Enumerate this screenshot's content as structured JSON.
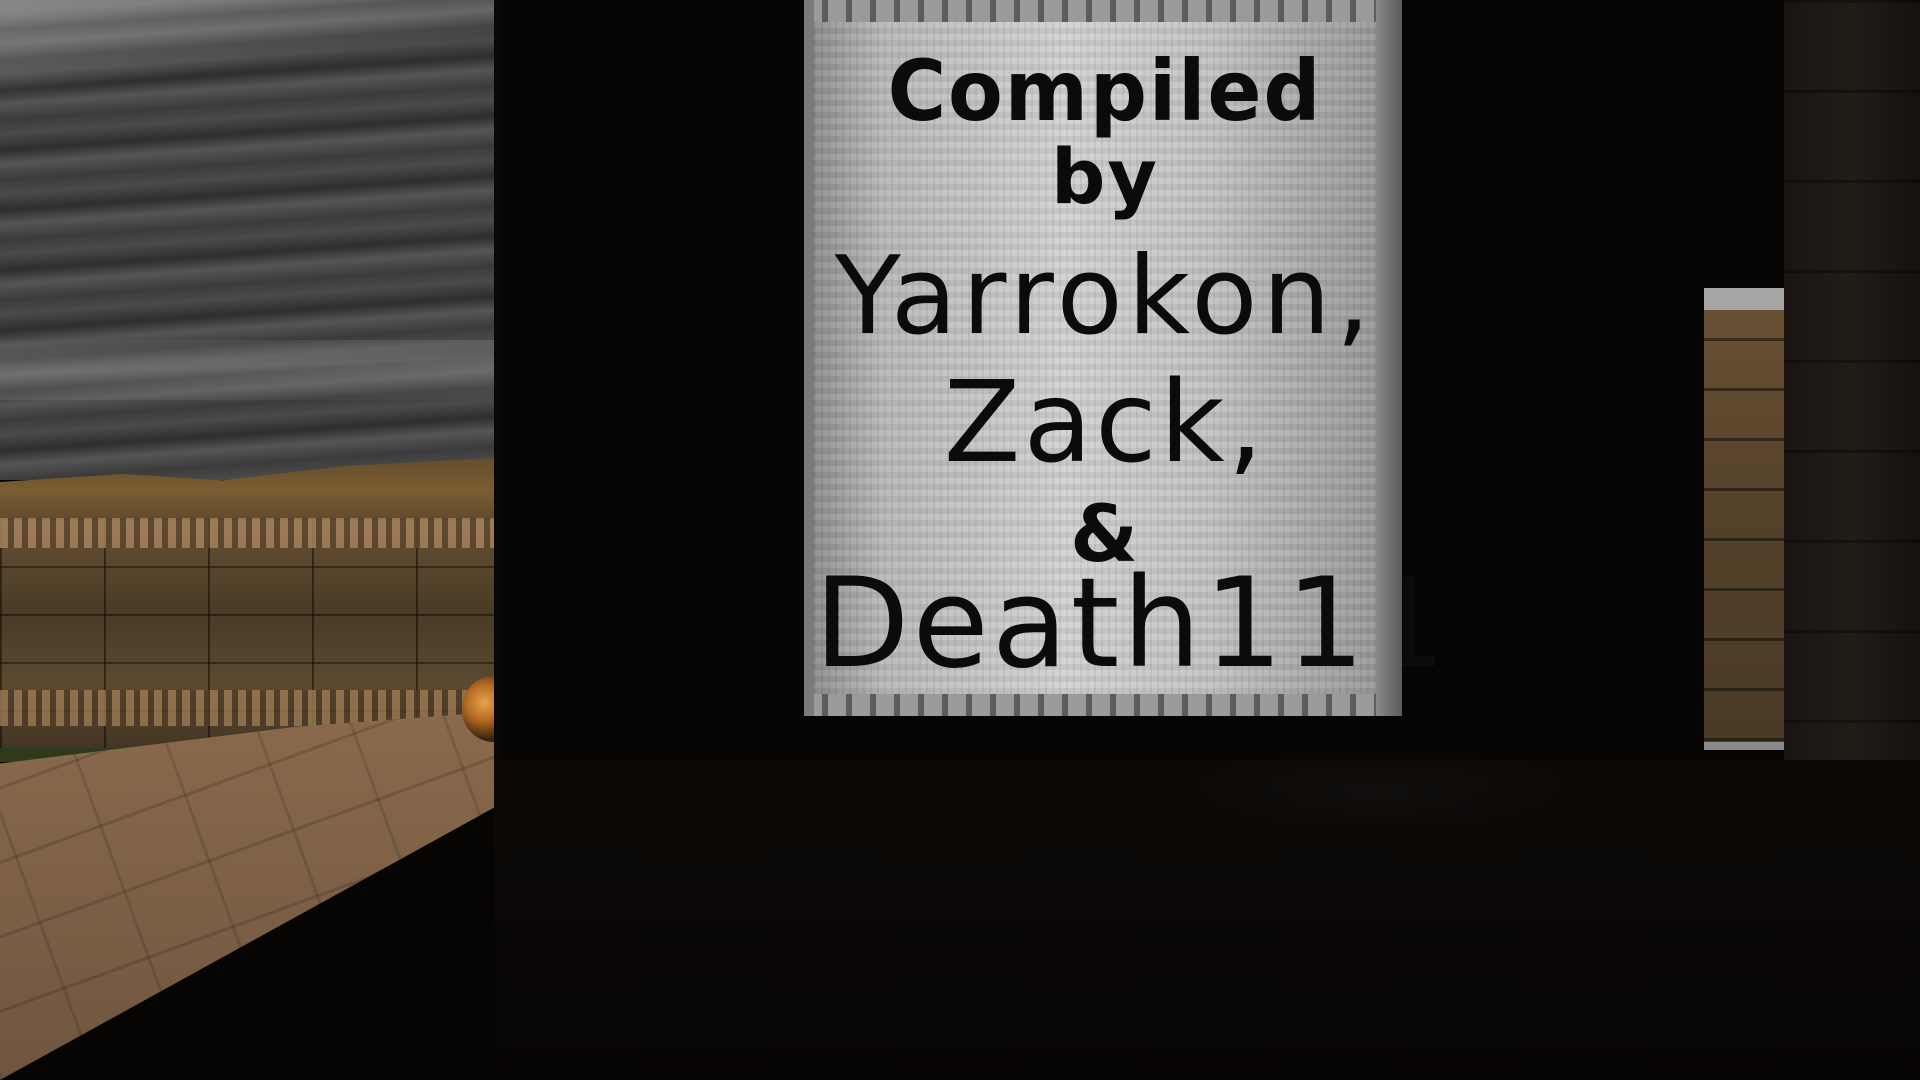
{
  "game": {
    "scene": "first-person level view",
    "sign": {
      "lines": [
        "Compiled",
        "by",
        "Yarrokon,",
        "Zack,",
        "&",
        "Death111"
      ]
    }
  },
  "colors": {
    "sign_text": "#0b0b0b",
    "sign_metal": "#c8c8c8",
    "interior_dark": "#060504",
    "brick": "#5e4a2f",
    "sky": "#3c3c3c"
  },
  "icons": {
    "pickup": "item-pickup-icon"
  }
}
